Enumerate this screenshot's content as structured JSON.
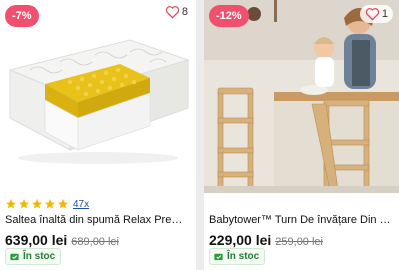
{
  "products": [
    {
      "discount": "-7%",
      "favorites": "8",
      "rating_count": "47x",
      "stars": 5,
      "title": "Saltea înaltă din spumă Relax Premi...",
      "price": "639,00 lei",
      "old_price": "689,00 lei",
      "stock": "În stoc",
      "image_icon": "mattress-image"
    },
    {
      "discount": "-12%",
      "favorites": "1",
      "title": "Babytower™ Turn De învățare Din Le...",
      "price": "229,00 lei",
      "old_price": "259,00 lei",
      "stock": "În stoc",
      "image_icon": "learning-tower-image"
    }
  ],
  "colors": {
    "badge": "#f0506e",
    "star": "#f2b800",
    "stock_text": "#2a7a35",
    "link": "#1f4fa8"
  }
}
